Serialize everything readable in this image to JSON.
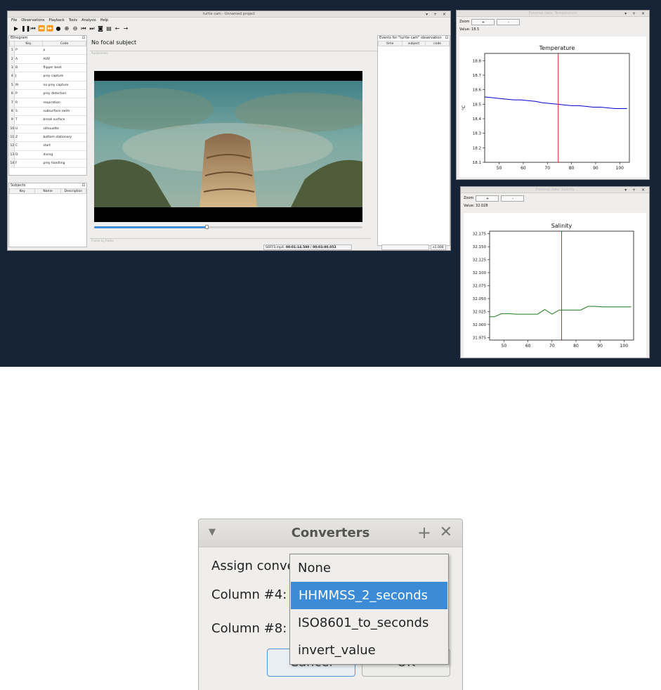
{
  "main_window": {
    "title": "turtle cam - Unnamed project",
    "menu": [
      "File",
      "Observations",
      "Playback",
      "Tools",
      "Analysis",
      "Help"
    ],
    "ethogram": {
      "title": "Ethogram",
      "columns": [
        "Key",
        "Code"
      ],
      "rows": [
        {
          "n": "1",
          "key": "P",
          "code": "p"
        },
        {
          "n": "2",
          "key": "A",
          "code": "AUV"
        },
        {
          "n": "3",
          "key": "B",
          "code": "flipper beat"
        },
        {
          "n": "4",
          "key": "J",
          "code": "prey capture"
        },
        {
          "n": "5",
          "key": "M",
          "code": "no prey capture"
        },
        {
          "n": "6",
          "key": "P",
          "code": "prey detection"
        },
        {
          "n": "7",
          "key": "R",
          "code": "respiration"
        },
        {
          "n": "8",
          "key": "S",
          "code": "subsurface swim"
        },
        {
          "n": "9",
          "key": "T",
          "code": "break surface"
        },
        {
          "n": "10",
          "key": "U",
          "code": "silhouette"
        },
        {
          "n": "11",
          "key": "Z",
          "code": "bottom stationary"
        },
        {
          "n": "12",
          "key": "C",
          "code": "start"
        },
        {
          "n": "13",
          "key": "D",
          "code": "diving"
        },
        {
          "n": "14",
          "key": "F",
          "code": "prey handling"
        }
      ]
    },
    "subjects": {
      "title": "Subjects",
      "columns": [
        "Key",
        "Name",
        "Description"
      ]
    },
    "focal_subject": "No focal subject",
    "audio_label": "Audio/video",
    "frame_label": "Frame by frame",
    "events": {
      "title": "Events for \"turtle cam\" observation",
      "columns": [
        "time",
        "subject",
        "code"
      ]
    },
    "status": {
      "file": "SOFFS.mp4:",
      "time": "00:01:14.500 / 00:03:00.053",
      "speed": "x1.000"
    },
    "seek_fraction": 0.42
  },
  "temperature_window": {
    "title": "External data: Temperature",
    "zoom_label": "Zoom",
    "zoom_in": "+",
    "zoom_out": "-",
    "value_label": "Value:",
    "value": "18.5",
    "chart_data": {
      "type": "line",
      "title": "Temperature",
      "ylabel": "°C",
      "xlim": [
        44,
        104
      ],
      "ylim": [
        18.1,
        18.85
      ],
      "xticks": [
        50,
        60,
        70,
        80,
        90,
        100
      ],
      "yticks": [
        18.1,
        18.2,
        18.3,
        18.4,
        18.5,
        18.6,
        18.7,
        18.8
      ],
      "cursor_x": 74.5,
      "color": "#0000cc",
      "cursor_color": "#d62728",
      "x": [
        44,
        47,
        50,
        53,
        56,
        59,
        62,
        65,
        68,
        71,
        74,
        77,
        80,
        83,
        86,
        89,
        92,
        95,
        98,
        101,
        103
      ],
      "y": [
        18.55,
        18.545,
        18.54,
        18.535,
        18.53,
        18.53,
        18.525,
        18.52,
        18.51,
        18.505,
        18.5,
        18.495,
        18.49,
        18.49,
        18.485,
        18.48,
        18.48,
        18.475,
        18.47,
        18.47,
        18.47
      ]
    }
  },
  "salinity_window": {
    "title": "External data: Salinity",
    "zoom_label": "Zoom",
    "zoom_in": "+",
    "zoom_out": "-",
    "value_label": "Value:",
    "value": "32.028",
    "chart_data": {
      "type": "line",
      "title": "Salinity",
      "xlim": [
        44,
        104
      ],
      "ylim": [
        31.97,
        32.18
      ],
      "xticks": [
        50,
        60,
        70,
        80,
        90,
        100
      ],
      "yticks": [
        31.975,
        32.0,
        32.025,
        32.05,
        32.075,
        32.1,
        32.125,
        32.15,
        32.175
      ],
      "cursor_x": 74,
      "color": "#1a7a1a",
      "cursor_color": "#d62728",
      "x": [
        44,
        46,
        49,
        52,
        55,
        58,
        61,
        64,
        67,
        70,
        73,
        76,
        79,
        82,
        85,
        88,
        91,
        94,
        97,
        100,
        103
      ],
      "y": [
        32.015,
        32.015,
        32.021,
        32.021,
        32.02,
        32.02,
        32.02,
        32.02,
        32.029,
        32.02,
        32.028,
        32.028,
        32.028,
        32.028,
        32.035,
        32.035,
        32.034,
        32.034,
        32.034,
        32.034,
        32.034
      ]
    }
  },
  "dialog": {
    "title": "Converters",
    "assign_label": "Assign conve",
    "column4_label": "Column #4:",
    "column8_label": "Column #8:",
    "cancel_label": "Cancel",
    "ok_label": "OK"
  },
  "dropdown": {
    "options": [
      "None",
      "HHMMSS_2_seconds",
      "ISO8601_to_seconds",
      "invert_value"
    ],
    "selected_index": 1
  },
  "colors": {
    "desktop": "#172336",
    "selection": "#3b8bd6",
    "accent_seek": "#3d8fd6"
  }
}
